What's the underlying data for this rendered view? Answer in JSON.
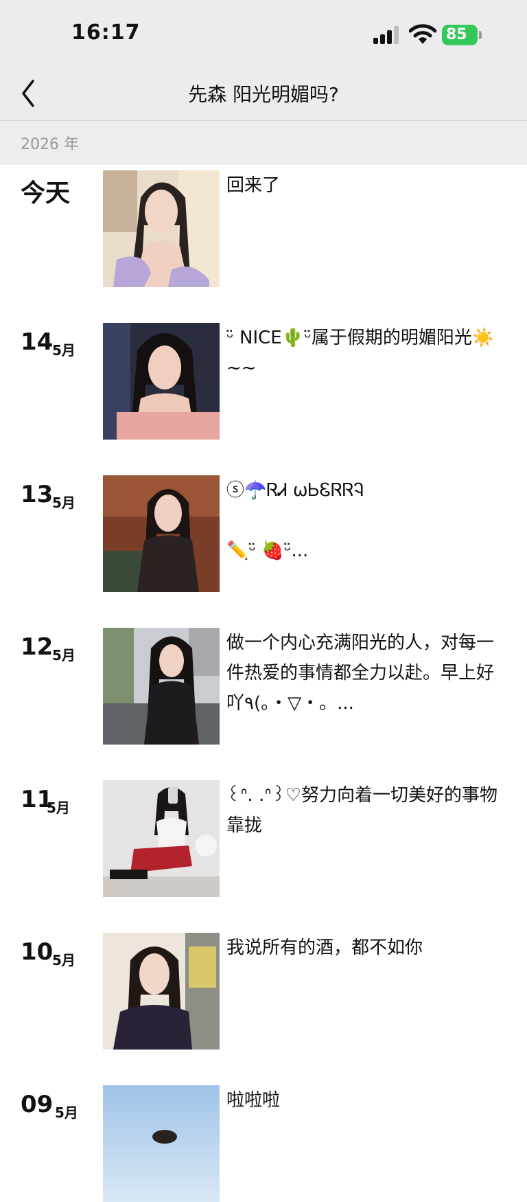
{
  "status_bar": {
    "time": "16:17",
    "battery": "85"
  },
  "nav": {
    "title": "先森 阳光明媚吗?"
  },
  "year_header": {
    "label": "2026 年"
  },
  "posts": [
    {
      "day": "今天",
      "month": "",
      "caption": "回来了"
    },
    {
      "day": "14",
      "month": "5月",
      "caption": "ᵕ̈ NICE🌵ᵕ̈属于假期的明媚阳光☀️~~"
    },
    {
      "day": "13",
      "month": "5月",
      "caption": "ⓢ☂️ᏒᏗ ωᏏᏋᏒᏒᎸ\n\n✏️ᵕ̈ 🍓ᵕ̈..."
    },
    {
      "day": "12",
      "month": "5月",
      "caption": "做一个内心充满阳光的人，对每一件热爱的事情都全力以赴。早上好吖٩(。・▽・。..."
    },
    {
      "day": "11",
      "month": "5月",
      "caption": "꒰ᐢ. .ᐢ꒱♡努力向着一切美好的事物靠拢"
    },
    {
      "day": "10",
      "month": "5月",
      "caption": "我说所有的酒，都不如你"
    },
    {
      "day": "09",
      "month": "5月",
      "caption": "啦啦啦"
    }
  ],
  "colors": {
    "header_bg": "#ececec",
    "year_bar_bg": "#ededed",
    "battery_green": "#34c759",
    "text": "#111111",
    "muted": "#9a9a9a"
  },
  "icons": [
    "back-chevron-icon",
    "cellular-signal-icon",
    "wifi-icon",
    "battery-icon"
  ]
}
